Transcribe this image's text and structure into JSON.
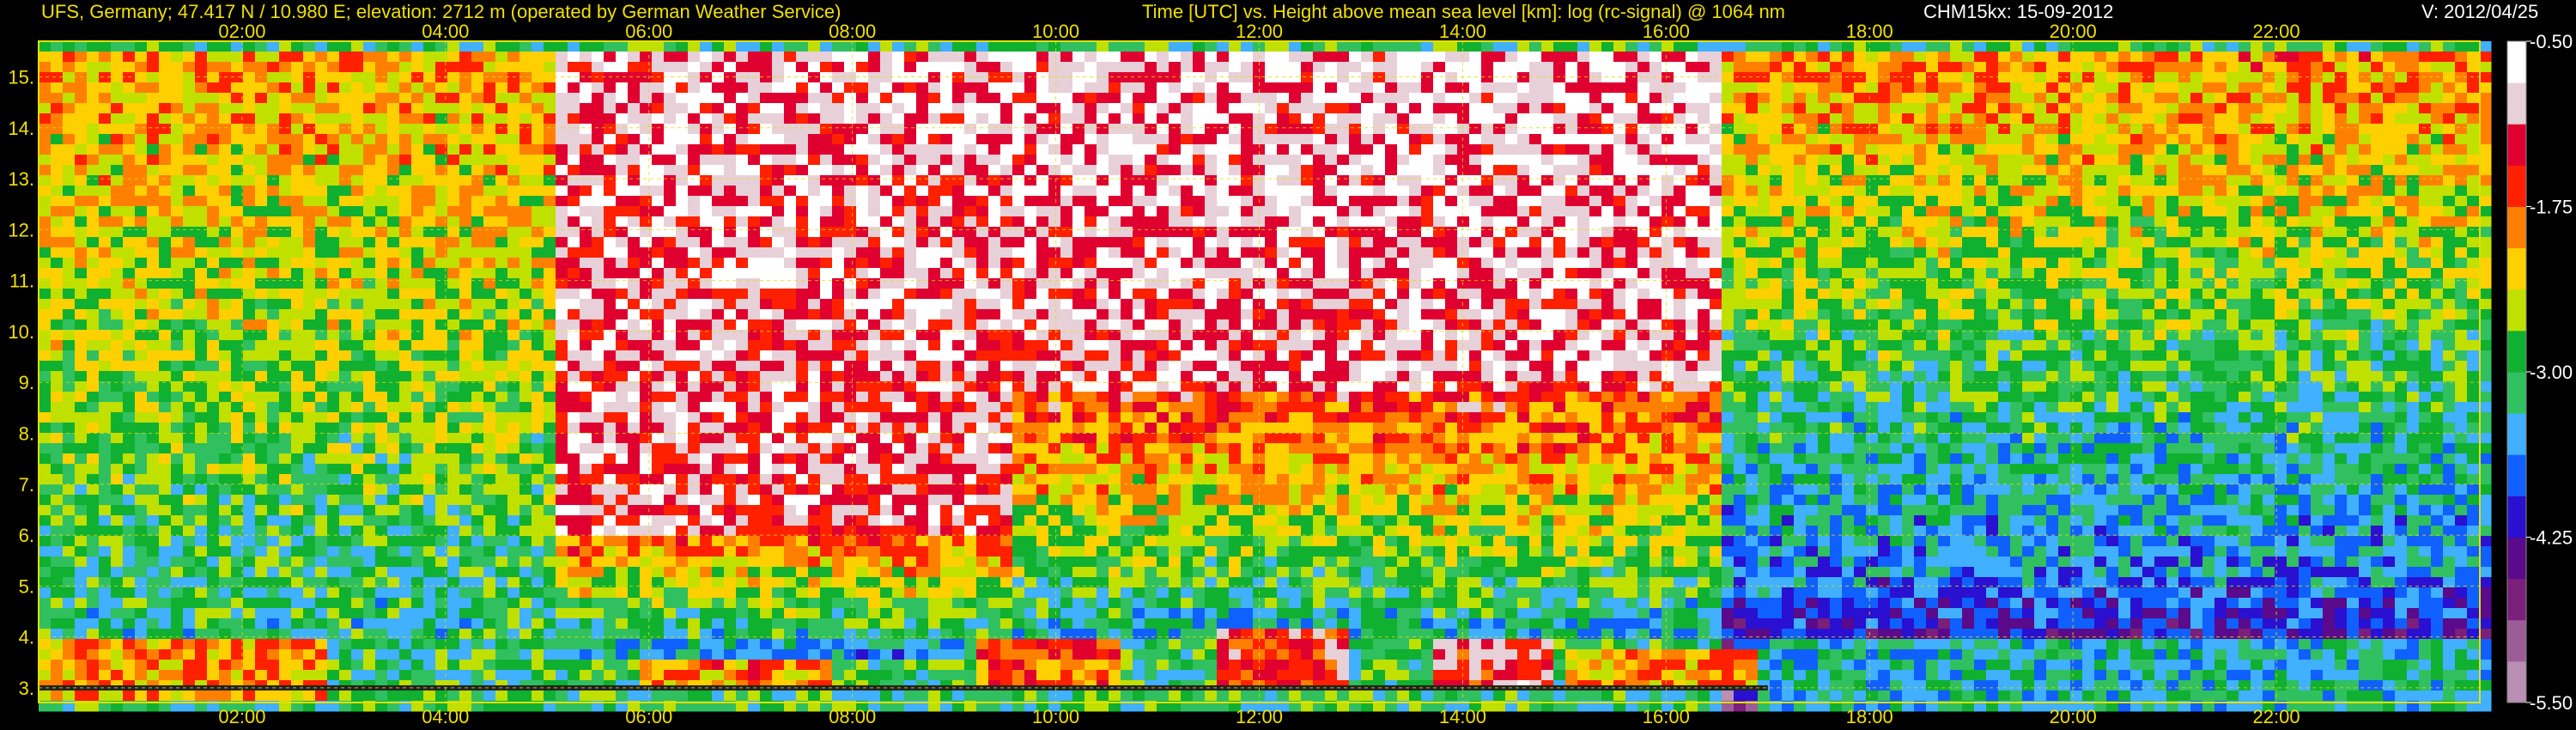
{
  "header": {
    "station": "UFS, Germany; 47.417 N / 10.980 E; elevation: 2712 m  (operated by German Weather Service)",
    "description": "Time [UTC] vs. Height above mean sea level [km]: log (rc-signal) @ 1064 nm",
    "instrument_date": "CHM15kx: 15-09-2012",
    "version": "V: 2012/04/25"
  },
  "chart_data": {
    "type": "heatmap",
    "title": "Time [UTC] vs. Height above mean sea level [km]: log (rc-signal) @ 1064 nm",
    "xlabel": "Time [UTC]",
    "ylabel": "Height above mean sea level [km]",
    "xlim_hours": [
      0.0,
      24.0
    ],
    "ylim_km": [
      2.712,
      15.7
    ],
    "x_ticks": [
      "02:00",
      "04:00",
      "06:00",
      "08:00",
      "10:00",
      "12:00",
      "14:00",
      "16:00",
      "18:00",
      "20:00",
      "22:00"
    ],
    "x_tick_hours": [
      2,
      4,
      6,
      8,
      10,
      12,
      14,
      16,
      18,
      20,
      22
    ],
    "y_ticks": [
      "3.",
      "4.",
      "5.",
      "6.",
      "7.",
      "8.",
      "9.",
      "10.",
      "11.",
      "12.",
      "13.",
      "14.",
      "15."
    ],
    "y_tick_values": [
      3,
      4,
      5,
      6,
      7,
      8,
      9,
      10,
      11,
      12,
      13,
      14,
      15
    ],
    "colorbar": {
      "ticks": [
        "-0.50",
        "-1.75",
        "-3.00",
        "-4.25",
        "-5.50"
      ],
      "tick_values": [
        -0.5,
        -1.75,
        -3.0,
        -4.25,
        -5.5
      ],
      "range": [
        -5.5,
        -0.5
      ],
      "colors_low_to_high": [
        "#b98fb4",
        "#9c5c98",
        "#7a1f7a",
        "#5a0a8a",
        "#2a10d0",
        "#1060ff",
        "#40b0ff",
        "#30c060",
        "#10b030",
        "#c0e000",
        "#ffd000",
        "#ff8000",
        "#ff2000",
        "#e00030",
        "#e8d0d8",
        "#ffffff"
      ]
    },
    "regions": [
      {
        "t0": 0.0,
        "t1": 5.0,
        "h0": 3.8,
        "h1": 15.7,
        "v0": -3.2,
        "v1": -2.0
      },
      {
        "t0": 5.0,
        "t1": 9.5,
        "h0": 6.0,
        "h1": 15.7,
        "v0": -1.2,
        "v1": -1.0
      },
      {
        "t0": 5.0,
        "t1": 9.5,
        "h0": 3.6,
        "h1": 6.0,
        "v0": -3.6,
        "v1": -1.8
      },
      {
        "t0": 9.5,
        "t1": 16.5,
        "h0": 9.0,
        "h1": 15.7,
        "v0": -1.1,
        "v1": -0.9
      },
      {
        "t0": 9.5,
        "t1": 16.5,
        "h0": 4.0,
        "h1": 9.0,
        "v0": -3.4,
        "v1": -1.5
      },
      {
        "t0": 16.5,
        "t1": 24.0,
        "h0": 5.5,
        "h1": 15.7,
        "v0": -3.6,
        "v1": -1.9
      },
      {
        "t0": 16.5,
        "t1": 24.0,
        "h0": 2.712,
        "h1": 5.5,
        "v0": -4.8,
        "v1": -3.6
      }
    ],
    "boundary_layer_features": [
      {
        "t0": 0.0,
        "t1": 2.8,
        "h0": 2.8,
        "h1": 4.0,
        "v": -2.0
      },
      {
        "t0": 5.8,
        "t1": 7.8,
        "h0": 3.0,
        "h1": 3.6,
        "v": -1.9
      },
      {
        "t0": 9.2,
        "t1": 10.6,
        "h0": 3.0,
        "h1": 4.0,
        "v": -1.8
      },
      {
        "t0": 11.5,
        "t1": 12.8,
        "h0": 3.0,
        "h1": 4.2,
        "v": -1.4
      },
      {
        "t0": 13.6,
        "t1": 14.8,
        "h0": 3.0,
        "h1": 4.0,
        "v": -1.3
      },
      {
        "t0": 15.0,
        "t1": 16.8,
        "h0": 3.0,
        "h1": 3.9,
        "v": -2.0
      },
      {
        "t0": 16.8,
        "t1": 24.0,
        "h0": 2.712,
        "h1": 4.0,
        "v": -3.3
      }
    ]
  }
}
